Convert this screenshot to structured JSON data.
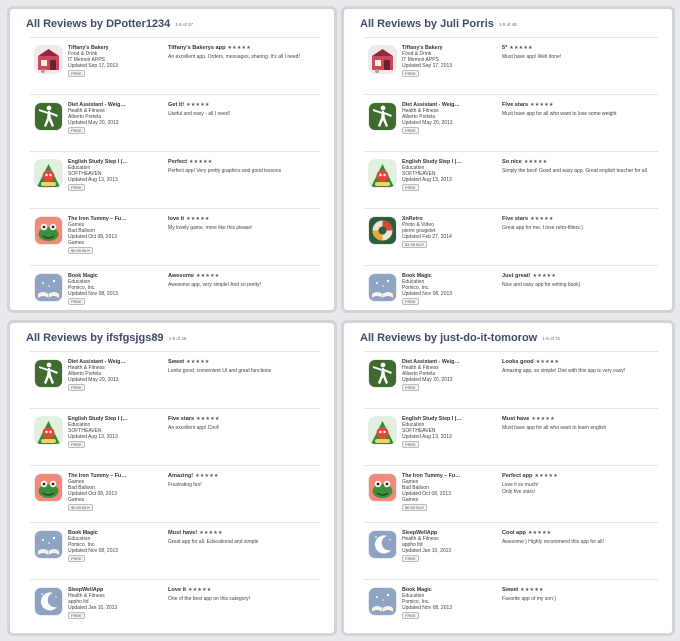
{
  "panels": [
    {
      "title": "All Reviews by DPotter1234",
      "count": "1-5 of 37",
      "reviews": [
        {
          "app_name": "Tiffany's Bakery",
          "category": "Food & Drink",
          "developer": "IT Memoir APPS",
          "updated": "Updated Sep 17, 2013",
          "price": "FREE",
          "title": "Tiffany's Bakerys app",
          "stars": "★★★★★",
          "text": "An excellent app. Orders, messages, sharing. It's all I need!",
          "icon": "bakery-icon"
        },
        {
          "app_name": "Diet Assistant - Weig…",
          "category": "Health & Fitness",
          "developer": "Alberto Portela",
          "updated": "Updated May 20, 2013",
          "price": "FREE",
          "title": "Get it!",
          "stars": "★★★★★",
          "text": "Useful and easy - all I need!",
          "icon": "diet-assistant-icon"
        },
        {
          "app_name": "English Study Step I (…",
          "category": "Education",
          "developer": "SOFTHEAVEN",
          "updated": "Updated Aug 13, 2013",
          "price": "FREE",
          "title": "Perfect",
          "stars": "★★★★★",
          "text": "Perfect app! Very pretty graphics and good lessons",
          "icon": "english-study-icon"
        },
        {
          "app_name": "The Iron Tummy – Fu…",
          "category": "Games",
          "developer": "Bad Balloon",
          "updated": "Updated Oct 08, 2013",
          "extra": "Games",
          "price": "$0.99 BUY",
          "title": "love it",
          "stars": "★★★★★",
          "text": "My lovely game, more like this please!",
          "icon": "iron-tummy-icon"
        },
        {
          "app_name": "Book Magic",
          "category": "Education",
          "developer": "Pomico, Inc.",
          "updated": "Updated Nov 08, 2013",
          "price": "FREE",
          "title": "Awesome",
          "stars": "★★★★★",
          "text": "Awesome app, very simple! And so pretty!",
          "icon": "book-magic-icon"
        }
      ]
    },
    {
      "title": "All Reviews by Juli Porris",
      "count": "1-5 of 48",
      "reviews": [
        {
          "app_name": "Tiffany's Bakery",
          "category": "Food & Drink",
          "developer": "IT Memoir APPS",
          "updated": "Updated Sep 17, 2013",
          "price": "FREE",
          "title": "5*",
          "stars": "★★★★★",
          "text": "Must have app! Well done!",
          "icon": "bakery-icon"
        },
        {
          "app_name": "Diet Assistant - Weig…",
          "category": "Health & Fitness",
          "developer": "Alberto Portela",
          "updated": "Updated May 20, 2013",
          "price": "FREE",
          "title": "Five stars",
          "stars": "★★★★★",
          "text": "Must have app for all who want to lose some weight",
          "icon": "diet-assistant-icon"
        },
        {
          "app_name": "English Study Step I (…",
          "category": "Education",
          "developer": "SOFTHEAVEN",
          "updated": "Updated Aug 13, 2013",
          "price": "FREE",
          "title": "So nice",
          "stars": "★★★★★",
          "text": "Simply the best! Good and easy app. Great english teacher for all",
          "icon": "english-study-icon"
        },
        {
          "app_name": "XnRetro",
          "category": "Photo & Video",
          "developer": "pierre gougelet",
          "updated": "Updated Feb 27, 2014",
          "price": "$1.99 BUY",
          "title": "Five stars",
          "stars": "★★★★★",
          "text": "Great app for me. I love retro-filters:)",
          "icon": "xnretro-icon"
        },
        {
          "app_name": "Book Magic",
          "category": "Education",
          "developer": "Pomico, Inc.",
          "updated": "Updated Nov 08, 2013",
          "price": "FREE",
          "title": "Just great!",
          "stars": "★★★★★",
          "text": "Nice and easy app for writing book)",
          "icon": "book-magic-icon"
        }
      ]
    },
    {
      "title": "All Reviews by ifsfgsjgs89",
      "count": "1-5 of 25",
      "reviews": [
        {
          "app_name": "Diet Assistant - Weig…",
          "category": "Health & Fitness",
          "developer": "Alberto Portela",
          "updated": "Updated May 20, 2013",
          "price": "FREE",
          "title": "Sweet",
          "stars": "★★★★★",
          "text": "Looks good, convenient UI and great functions",
          "icon": "diet-assistant-icon"
        },
        {
          "app_name": "English Study Step I (…",
          "category": "Education",
          "developer": "SOFTHEAVEN",
          "updated": "Updated Aug 13, 2013",
          "price": "FREE",
          "title": "Five stars",
          "stars": "★★★★★",
          "text": "An excellent app! Cool!",
          "icon": "english-study-icon"
        },
        {
          "app_name": "The Iron Tummy – Fu…",
          "category": "Games",
          "developer": "Bad Balloon",
          "updated": "Updated Oct 08, 2013",
          "extra": "Games",
          "price": "$0.99 BUY",
          "title": "Amazing!",
          "stars": "★★★★★",
          "text": "Frustrating fun!",
          "icon": "iron-tummy-icon"
        },
        {
          "app_name": "Book Magic",
          "category": "Education",
          "developer": "Pomico, Inc.",
          "updated": "Updated Nov 08, 2013",
          "price": "FREE",
          "title": "Must have!",
          "stars": "★★★★★",
          "text": "Great app for all. Educational and simple",
          "icon": "book-magic-icon"
        },
        {
          "app_name": "SleepWellApp",
          "category": "Health & Fitness",
          "developer": "appho ltd",
          "updated": "Updated Jan 10, 2013",
          "price": "FREE",
          "title": "Love it",
          "stars": "★★★★★",
          "text": "One of the best app on this category!",
          "icon": "sleepwell-icon"
        }
      ]
    },
    {
      "title": "All Reviews by just-do-it-tomorow",
      "count": "1-5 of 72",
      "reviews": [
        {
          "app_name": "Diet Assistant - Weig…",
          "category": "Health & Fitness",
          "developer": "Alberto Portela",
          "updated": "Updated May 20, 2013",
          "price": "FREE",
          "title": "Looks good",
          "stars": "★★★★★",
          "text": "Amazing app, so simple! Diet with this app is very easy!",
          "icon": "diet-assistant-icon"
        },
        {
          "app_name": "English Study Step I (…",
          "category": "Education",
          "developer": "SOFTHEAVEN",
          "updated": "Updated Aug 13, 2013",
          "price": "FREE",
          "title": "Must have",
          "stars": "★★★★★",
          "text": "Must have app for all who want to learn english",
          "icon": "english-study-icon"
        },
        {
          "app_name": "The Iron Tummy – Fu…",
          "category": "Games",
          "developer": "Bad Balloon",
          "updated": "Updated Oct 08, 2013",
          "extra": "Games",
          "price": "$0.99 BUY",
          "title": "Perfect app",
          "stars": "★★★★★",
          "text": "Love it so much!\nOnly five stars!",
          "icon": "iron-tummy-icon"
        },
        {
          "app_name": "SleepWellApp",
          "category": "Health & Fitness",
          "developer": "appho ltd",
          "updated": "Updated Jan 10, 2013",
          "price": "FREE",
          "title": "Cool app",
          "stars": "★★★★★",
          "text": "Awesome:) Highly recommend this app for all!",
          "icon": "sleepwell-icon"
        },
        {
          "app_name": "Book Magic",
          "category": "Education",
          "developer": "Pomico, Inc.",
          "updated": "Updated Nov 08, 2013",
          "price": "FREE",
          "title": "Sweet",
          "stars": "★★★★★",
          "text": "Favorite app of my son:)",
          "icon": "book-magic-icon"
        }
      ]
    }
  ]
}
